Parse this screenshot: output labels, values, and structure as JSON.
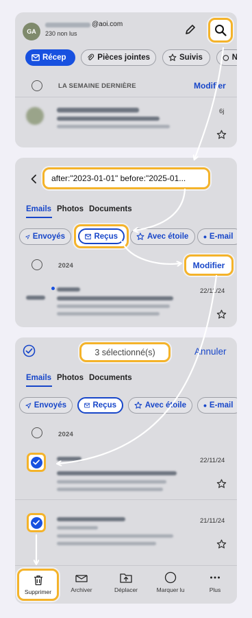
{
  "panel1": {
    "avatar": "GA",
    "email_domain": "@aoi.com",
    "unread": "230 non lus",
    "chips": [
      "Récep",
      "Pièces jointes",
      "Suivis",
      "N"
    ],
    "section": "LA SEMAINE DERNIÈRE",
    "modify": "Modifier",
    "message_time": "6j"
  },
  "panel2": {
    "search_query": "after:\"2023-01-01\" before:\"2025-01...",
    "tabs": [
      "Emails",
      "Photos",
      "Documents"
    ],
    "chips": [
      "Envoyés",
      "Reçus",
      "Avec étoile",
      "E-mail"
    ],
    "year": "2024",
    "modify": "Modifier",
    "message_time": "22/11/24"
  },
  "panel3": {
    "selected_count": "3 sélectionné(s)",
    "cancel": "Annuler",
    "tabs": [
      "Emails",
      "Photos",
      "Documents"
    ],
    "chips": [
      "Envoyés",
      "Reçus",
      "Avec étoile",
      "E-mail"
    ],
    "year": "2024",
    "message1_time": "22/11/24",
    "message2_time": "21/11/24",
    "bottom_bar": [
      "Supprimer",
      "Archiver",
      "Déplacer",
      "Marquer lu",
      "Plus"
    ]
  },
  "colors": {
    "accent": "#1851e0",
    "highlight": "#f4b32a",
    "panel_bg": "#dcdce0",
    "page_bg": "#f1f0f7"
  },
  "icons": [
    "search-icon",
    "edit-icon",
    "mail-icon",
    "paperclip-icon",
    "star-icon",
    "back-arrow-icon",
    "send-icon",
    "check-icon",
    "trash-icon",
    "archive-icon",
    "move-icon",
    "circle-icon",
    "more-icon"
  ]
}
